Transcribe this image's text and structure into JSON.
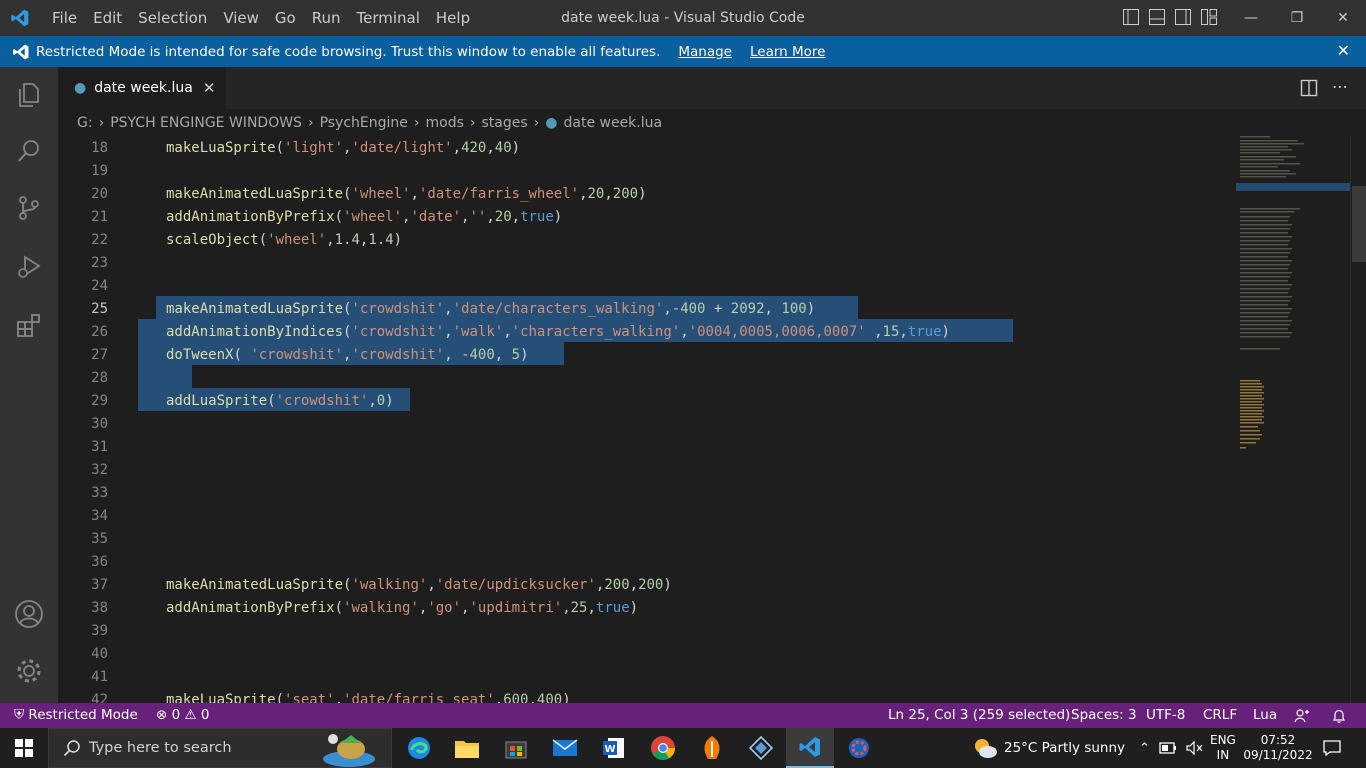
{
  "titlebar": {
    "menu": [
      "File",
      "Edit",
      "Selection",
      "View",
      "Go",
      "Run",
      "Terminal",
      "Help"
    ],
    "title": "date week.lua - Visual Studio Code"
  },
  "banner": {
    "message": "Restricted Mode is intended for safe code browsing. Trust this window to enable all features.",
    "manage": "Manage",
    "learn_more": "Learn More"
  },
  "tab": {
    "label": "date week.lua"
  },
  "breadcrumb": [
    "G:",
    "PSYCH ENGINGE WINDOWS",
    "PsychEngine",
    "mods",
    "stages",
    "date week.lua"
  ],
  "editor": {
    "lines": [
      {
        "n": "18",
        "text": "makeLuaSprite('light','date/light',420,40)"
      },
      {
        "n": "19",
        "text": ""
      },
      {
        "n": "20",
        "text": "makeAnimatedLuaSprite('wheel','date/farris_wheel',20,200)"
      },
      {
        "n": "21",
        "text": "addAnimationByPrefix('wheel','date','',20,true)"
      },
      {
        "n": "22",
        "text": "scaleObject('wheel',1.4,1.4)"
      },
      {
        "n": "23",
        "text": ""
      },
      {
        "n": "24",
        "text": ""
      },
      {
        "n": "25",
        "text": "makeAnimatedLuaSprite('crowdshit','date/characters_walking',-400 + 2092, 100)"
      },
      {
        "n": "26",
        "text": "addAnimationByIndices('crowdshit','walk','characters_walking','0004,0005,0006,0007' ,15,true)"
      },
      {
        "n": "27",
        "text": "doTweenX( 'crowdshit','crowdshit', -400, 5)"
      },
      {
        "n": "28",
        "text": ""
      },
      {
        "n": "29",
        "text": "addLuaSprite('crowdshit',0)"
      },
      {
        "n": "30",
        "text": ""
      },
      {
        "n": "31",
        "text": ""
      },
      {
        "n": "32",
        "text": ""
      },
      {
        "n": "33",
        "text": ""
      },
      {
        "n": "34",
        "text": ""
      },
      {
        "n": "35",
        "text": ""
      },
      {
        "n": "36",
        "text": ""
      },
      {
        "n": "37",
        "text": "makeAnimatedLuaSprite('walking','date/updicksucker',200,200)"
      },
      {
        "n": "38",
        "text": "addAnimationByPrefix('walking','go','updimitri',25,true)"
      },
      {
        "n": "39",
        "text": ""
      },
      {
        "n": "40",
        "text": ""
      },
      {
        "n": "41",
        "text": ""
      },
      {
        "n": "42",
        "text": "makeLuaSprite('seat','date/farris_seat',600,400)"
      }
    ]
  },
  "statusbar": {
    "restricted": "Restricted Mode",
    "errors": "0",
    "warnings": "0",
    "position": "Ln 25, Col 3 (259 selected)",
    "spaces": "Spaces: 3",
    "encoding": "UTF-8",
    "eol": "CRLF",
    "language": "Lua"
  },
  "taskbar": {
    "search_placeholder": "Type here to search",
    "weather": "25°C  Partly sunny",
    "lang_top": "ENG",
    "lang_bottom": "IN",
    "time": "07:52",
    "date": "09/11/2022"
  },
  "colors": {
    "accent_blue": "#0a5f9e",
    "status_purple": "#68217a",
    "selection": "#264f78"
  }
}
